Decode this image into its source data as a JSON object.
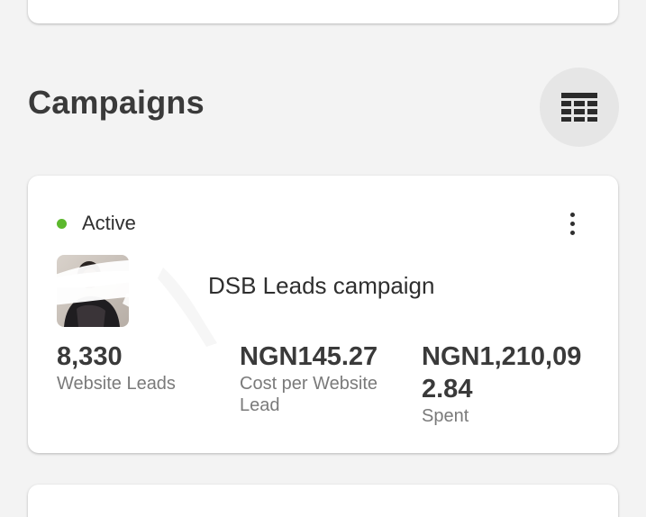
{
  "section": {
    "title": "Campaigns",
    "view_toggle_icon": "table-grid-icon"
  },
  "campaign": {
    "status": "Active",
    "status_color": "#5cb82d",
    "name": "DSB Leads campaign",
    "more_icon": "more-vertical-icon",
    "metrics": [
      {
        "value": "8,330",
        "label": "Website Leads"
      },
      {
        "value": "NGN145.27",
        "label": "Cost per Website Lead"
      },
      {
        "value": "NGN1,210,092.84",
        "label": "Spent"
      }
    ]
  }
}
